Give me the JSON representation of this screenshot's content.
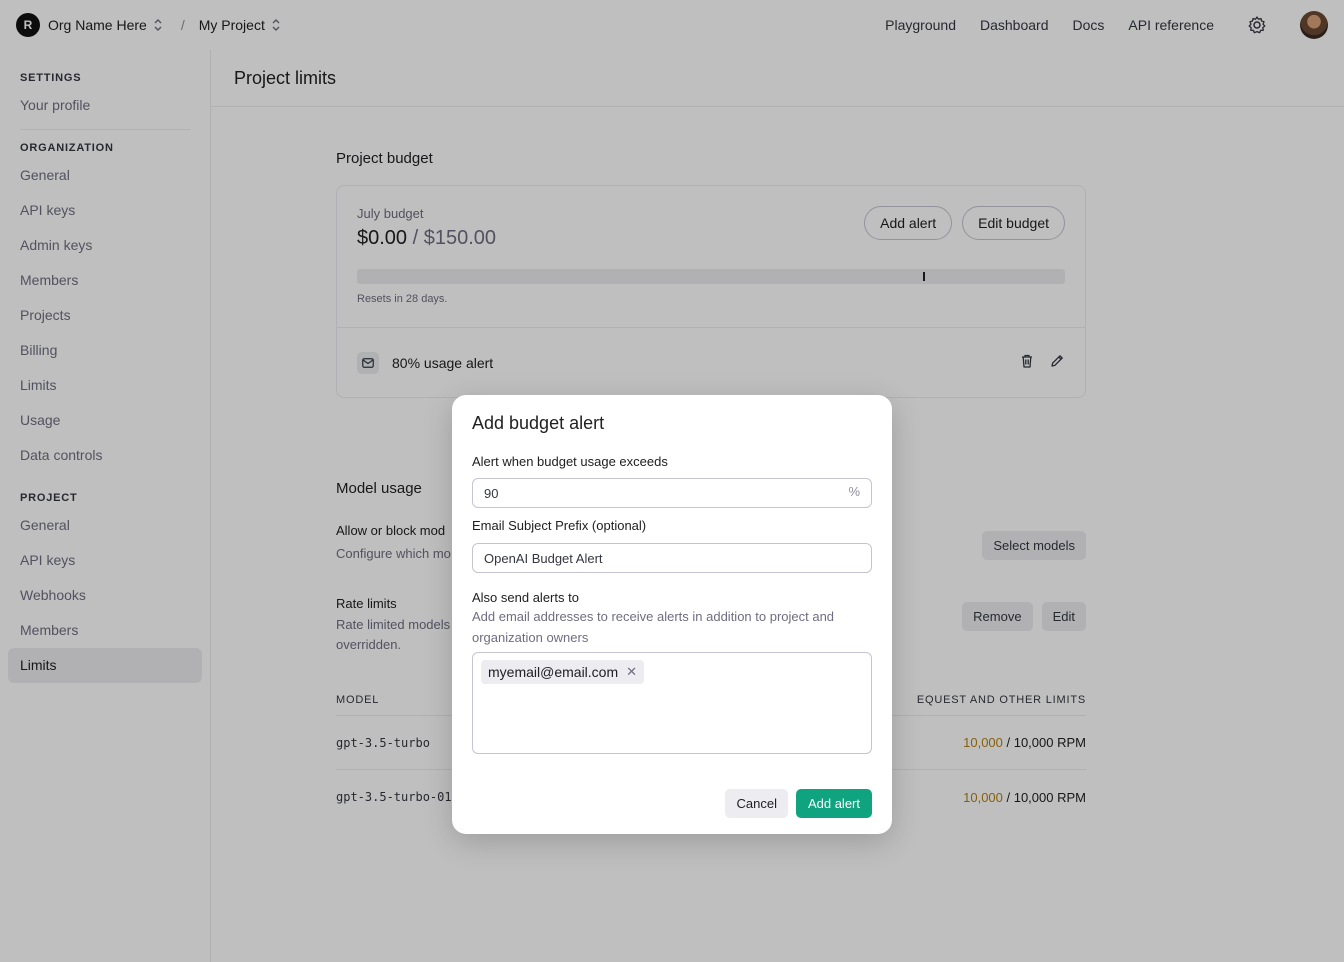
{
  "topbar": {
    "org_initial": "R",
    "org_name": "Org Name Here",
    "separator": "/",
    "project_name": "My Project",
    "nav": [
      "Playground",
      "Dashboard",
      "Docs",
      "API reference"
    ]
  },
  "sidebar": {
    "settings_heading": "SETTINGS",
    "settings_items": [
      "Your profile"
    ],
    "org_heading": "ORGANIZATION",
    "org_items": [
      "General",
      "API keys",
      "Admin keys",
      "Members",
      "Projects",
      "Billing",
      "Limits",
      "Usage",
      "Data controls"
    ],
    "project_heading": "PROJECT",
    "project_items": [
      "General",
      "API keys",
      "Webhooks",
      "Members",
      "Limits"
    ],
    "active_item": "Limits"
  },
  "page": {
    "title": "Project limits"
  },
  "budget": {
    "section_title": "Project budget",
    "label": "July budget",
    "spent": "$0.00",
    "divider": " / ",
    "limit": "$150.00",
    "add_alert_label": "Add alert",
    "edit_budget_label": "Edit budget",
    "usage_fraction": 0.0,
    "alert_marker_fraction": 0.8,
    "reset_text": "Resets in 28 days.",
    "alert_label": "80% usage alert"
  },
  "model_usage": {
    "section_title": "Model usage",
    "allow_block_title": "Allow or block mod",
    "allow_block_desc": "Configure which mo",
    "select_models_label": "Select models",
    "rate_limits_title": "Rate limits",
    "rate_limits_desc_1": "Rate limited models",
    "rate_limits_desc_2": "overridden.",
    "remove_label": "Remove",
    "edit_label": "Edit",
    "col_model": "MODEL",
    "col_limits": "EQUEST AND OTHER LIMITS",
    "rows": [
      {
        "model": "gpt-3.5-turbo",
        "used": "10,000",
        "limit": " / 10,000 RPM"
      },
      {
        "model": "gpt-3.5-turbo-01",
        "used": "10,000",
        "limit": " / 10,000 RPM"
      }
    ]
  },
  "modal": {
    "title": "Add budget alert",
    "threshold_label": "Alert when budget usage exceeds",
    "threshold_value": "90",
    "threshold_suffix": "%",
    "prefix_label": "Email Subject Prefix (optional)",
    "prefix_value": "OpenAI Budget Alert",
    "recipients_label": "Also send alerts to",
    "recipients_help": "Add email addresses to receive alerts in addition to project and organization owners",
    "emails": [
      "myemail@email.com"
    ],
    "cancel_label": "Cancel",
    "submit_label": "Add alert"
  },
  "colors": {
    "accent": "#10a37f",
    "warning_text": "#b58012"
  }
}
